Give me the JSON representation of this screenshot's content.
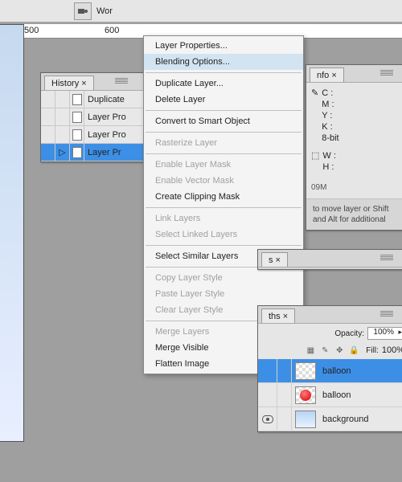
{
  "window_buttons": [
    "—",
    "□",
    "×"
  ],
  "toolbar": {
    "label": "Wor"
  },
  "ruler_marks": [
    {
      "pos": 30,
      "label": "500"
    },
    {
      "pos": 130,
      "label": "600"
    }
  ],
  "history": {
    "tab": "History",
    "rows": [
      {
        "label": "Duplicate",
        "sel": false
      },
      {
        "label": "Layer Pro",
        "sel": false
      },
      {
        "label": "Layer Pro",
        "sel": false
      },
      {
        "label": "Layer Pr",
        "sel": true
      }
    ]
  },
  "context_menu": [
    {
      "label": "Layer Properties...",
      "type": "item"
    },
    {
      "label": "Blending Options...",
      "type": "item",
      "hi": true
    },
    {
      "type": "sep"
    },
    {
      "label": "Duplicate Layer...",
      "type": "item"
    },
    {
      "label": "Delete Layer",
      "type": "item"
    },
    {
      "type": "sep"
    },
    {
      "label": "Convert to Smart Object",
      "type": "item"
    },
    {
      "type": "sep"
    },
    {
      "label": "Rasterize Layer",
      "type": "item",
      "dis": true
    },
    {
      "type": "sep"
    },
    {
      "label": "Enable Layer Mask",
      "type": "item",
      "dis": true
    },
    {
      "label": "Enable Vector Mask",
      "type": "item",
      "dis": true
    },
    {
      "label": "Create Clipping Mask",
      "type": "item"
    },
    {
      "type": "sep"
    },
    {
      "label": "Link Layers",
      "type": "item",
      "dis": true
    },
    {
      "label": "Select Linked Layers",
      "type": "item",
      "dis": true
    },
    {
      "type": "sep"
    },
    {
      "label": "Select Similar Layers",
      "type": "item"
    },
    {
      "type": "sep"
    },
    {
      "label": "Copy Layer Style",
      "type": "item",
      "dis": true
    },
    {
      "label": "Paste Layer Style",
      "type": "item",
      "dis": true
    },
    {
      "label": "Clear Layer Style",
      "type": "item",
      "dis": true
    },
    {
      "type": "sep"
    },
    {
      "label": "Merge Layers",
      "type": "item",
      "dis": true
    },
    {
      "label": "Merge Visible",
      "type": "item"
    },
    {
      "label": "Flatten Image",
      "type": "item"
    }
  ],
  "info_panel": {
    "tab": "nfo",
    "lines": [
      "C :",
      "M :",
      "Y :",
      "K :",
      "8-bit",
      "W :",
      "H :"
    ],
    "mem": "09M",
    "tip": "to move layer or Shift and Alt for additional"
  },
  "mini_panel": {
    "tab": "s",
    "ths": "ths"
  },
  "layers": {
    "opacity_label": "Opacity:",
    "opacity_val": "100%",
    "fill_label": "Fill:",
    "fill_val": "100%",
    "rows": [
      {
        "name": "balloon",
        "sel": true,
        "thumb": "chk",
        "eye": false
      },
      {
        "name": "balloon",
        "sel": false,
        "thumb": "balloon",
        "eye": false
      },
      {
        "name": "background",
        "sel": false,
        "thumb": "grad",
        "eye": true
      }
    ]
  }
}
